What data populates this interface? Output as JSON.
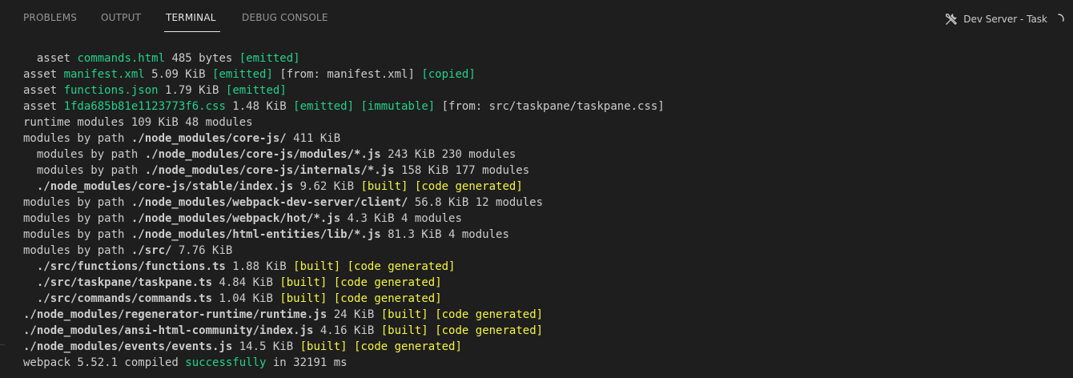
{
  "tabs": [
    {
      "label": "PROBLEMS"
    },
    {
      "label": "OUTPUT"
    },
    {
      "label": "TERMINAL"
    },
    {
      "label": "DEBUG CONSOLE"
    }
  ],
  "active_tab": "TERMINAL",
  "task": {
    "label": "Dev Server - Task",
    "icon": "tools-icon",
    "status_icon": "spinner-icon"
  },
  "colors": {
    "background": "#1e1e1e",
    "text": "#cccccc",
    "green": "#23d18b",
    "yellow": "#f5f543"
  },
  "terminal_lines": [
    [
      {
        "t": "  asset ",
        "c": "w"
      },
      {
        "t": "commands.html",
        "c": "g"
      },
      {
        "t": " 485 bytes ",
        "c": "w"
      },
      {
        "t": "[emitted]",
        "c": "g"
      }
    ],
    [
      {
        "t": "asset ",
        "c": "w"
      },
      {
        "t": "manifest.xml",
        "c": "g"
      },
      {
        "t": " 5.09 KiB ",
        "c": "w"
      },
      {
        "t": "[emitted]",
        "c": "g"
      },
      {
        "t": " [from: manifest.xml] ",
        "c": "w"
      },
      {
        "t": "[copied]",
        "c": "g"
      }
    ],
    [
      {
        "t": "asset ",
        "c": "w"
      },
      {
        "t": "functions.json",
        "c": "g"
      },
      {
        "t": " 1.79 KiB ",
        "c": "w"
      },
      {
        "t": "[emitted]",
        "c": "g"
      }
    ],
    [
      {
        "t": "asset ",
        "c": "w"
      },
      {
        "t": "1fda685b81e1123773f6.css",
        "c": "g"
      },
      {
        "t": " 1.48 KiB ",
        "c": "w"
      },
      {
        "t": "[emitted]",
        "c": "g"
      },
      {
        "t": " ",
        "c": "w"
      },
      {
        "t": "[immutable]",
        "c": "g"
      },
      {
        "t": " [from: src/taskpane/taskpane.css]",
        "c": "w"
      }
    ],
    [
      {
        "t": "runtime modules 109 KiB 48 modules",
        "c": "w"
      }
    ],
    [
      {
        "t": "modules by path ",
        "c": "w"
      },
      {
        "t": "./node_modules/core-js/",
        "c": "w",
        "b": true
      },
      {
        "t": " 411 KiB",
        "c": "w"
      }
    ],
    [
      {
        "t": "  modules by path ",
        "c": "w"
      },
      {
        "t": "./node_modules/core-js/modules/*.js",
        "c": "w",
        "b": true
      },
      {
        "t": " 243 KiB 230 modules",
        "c": "w"
      }
    ],
    [
      {
        "t": "  modules by path ",
        "c": "w"
      },
      {
        "t": "./node_modules/core-js/internals/*.js",
        "c": "w",
        "b": true
      },
      {
        "t": " 158 KiB 177 modules",
        "c": "w"
      }
    ],
    [
      {
        "t": "  ./node_modules/core-js/stable/index.js",
        "c": "w",
        "b": true
      },
      {
        "t": " 9.62 KiB ",
        "c": "w"
      },
      {
        "t": "[built]",
        "c": "y"
      },
      {
        "t": " ",
        "c": "w"
      },
      {
        "t": "[code generated]",
        "c": "y"
      }
    ],
    [
      {
        "t": "modules by path ",
        "c": "w"
      },
      {
        "t": "./node_modules/webpack-dev-server/client/",
        "c": "w",
        "b": true
      },
      {
        "t": " 56.8 KiB 12 modules",
        "c": "w"
      }
    ],
    [
      {
        "t": "modules by path ",
        "c": "w"
      },
      {
        "t": "./node_modules/webpack/hot/*.js",
        "c": "w",
        "b": true
      },
      {
        "t": " 4.3 KiB 4 modules",
        "c": "w"
      }
    ],
    [
      {
        "t": "modules by path ",
        "c": "w"
      },
      {
        "t": "./node_modules/html-entities/lib/*.js",
        "c": "w",
        "b": true
      },
      {
        "t": " 81.3 KiB 4 modules",
        "c": "w"
      }
    ],
    [
      {
        "t": "modules by path ",
        "c": "w"
      },
      {
        "t": "./src/",
        "c": "w",
        "b": true
      },
      {
        "t": " 7.76 KiB",
        "c": "w"
      }
    ],
    [
      {
        "t": "  ./src/functions/functions.ts",
        "c": "w",
        "b": true
      },
      {
        "t": " 1.88 KiB ",
        "c": "w"
      },
      {
        "t": "[built]",
        "c": "y"
      },
      {
        "t": " ",
        "c": "w"
      },
      {
        "t": "[code generated]",
        "c": "y"
      }
    ],
    [
      {
        "t": "  ./src/taskpane/taskpane.ts",
        "c": "w",
        "b": true
      },
      {
        "t": " 4.84 KiB ",
        "c": "w"
      },
      {
        "t": "[built]",
        "c": "y"
      },
      {
        "t": " ",
        "c": "w"
      },
      {
        "t": "[code generated]",
        "c": "y"
      }
    ],
    [
      {
        "t": "  ./src/commands/commands.ts",
        "c": "w",
        "b": true
      },
      {
        "t": " 1.04 KiB ",
        "c": "w"
      },
      {
        "t": "[built]",
        "c": "y"
      },
      {
        "t": " ",
        "c": "w"
      },
      {
        "t": "[code generated]",
        "c": "y"
      }
    ],
    [
      {
        "t": "./node_modules/regenerator-runtime/runtime.js",
        "c": "w",
        "b": true
      },
      {
        "t": " 24 KiB ",
        "c": "w"
      },
      {
        "t": "[built]",
        "c": "y"
      },
      {
        "t": " ",
        "c": "w"
      },
      {
        "t": "[code generated]",
        "c": "y"
      }
    ],
    [
      {
        "t": "./node_modules/ansi-html-community/index.js",
        "c": "w",
        "b": true
      },
      {
        "t": " 4.16 KiB ",
        "c": "w"
      },
      {
        "t": "[built]",
        "c": "y"
      },
      {
        "t": " ",
        "c": "w"
      },
      {
        "t": "[code generated]",
        "c": "y"
      }
    ],
    [
      {
        "t": "./node_modules/events/events.js",
        "c": "w",
        "b": true
      },
      {
        "t": " 14.5 KiB ",
        "c": "w"
      },
      {
        "t": "[built]",
        "c": "y"
      },
      {
        "t": " ",
        "c": "w"
      },
      {
        "t": "[code generated]",
        "c": "y"
      }
    ],
    [
      {
        "t": "webpack 5.52.1 compiled ",
        "c": "w"
      },
      {
        "t": "successfully",
        "c": "g"
      },
      {
        "t": " in 32191 ms",
        "c": "w"
      }
    ]
  ]
}
